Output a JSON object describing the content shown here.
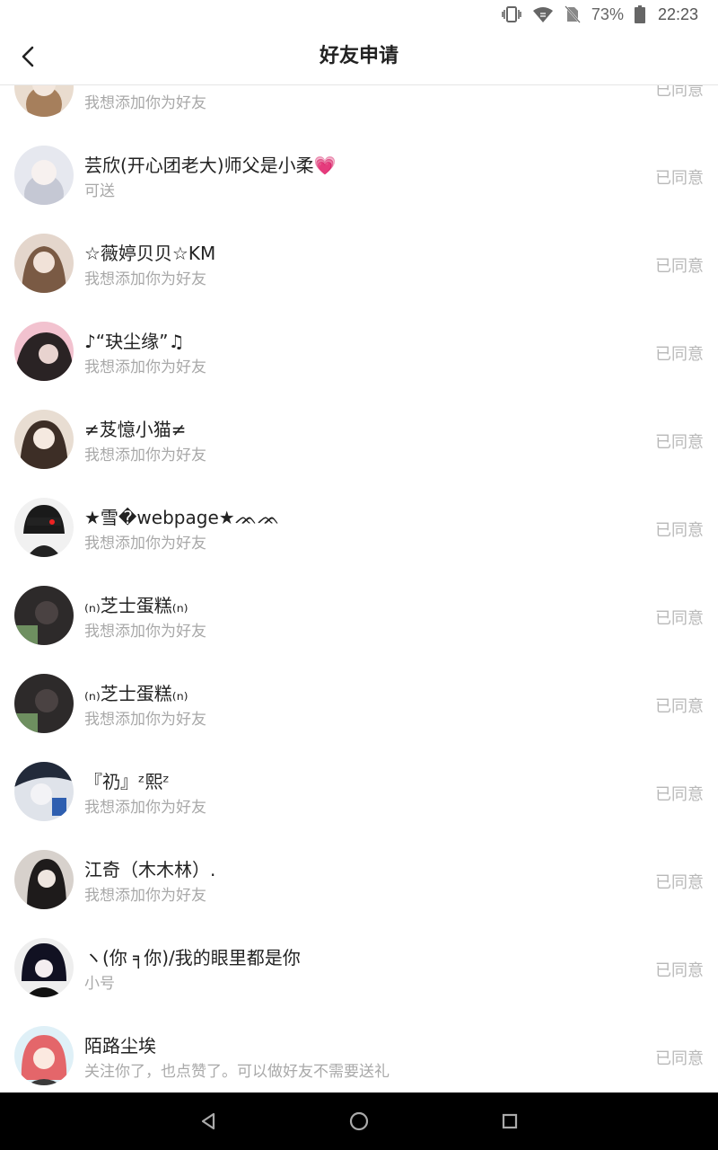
{
  "status": {
    "battery": "73%",
    "time": "22:23"
  },
  "header": {
    "title": "好友申请"
  },
  "requests": [
    {
      "name": "",
      "message": "我想添加你为好友",
      "action": "已同意",
      "avatar": {
        "bg": "#e9dccf",
        "fg": "#a67f5c"
      }
    },
    {
      "name": "芸欣(开心团老大)师父是小柔💗",
      "message": "可送",
      "action": "已同意",
      "avatar": {
        "bg": "#e6e8ef",
        "fg": "#c5c8d4"
      }
    },
    {
      "name": "☆薇婷贝贝☆KM",
      "message": "我想添加你为好友",
      "action": "已同意",
      "avatar": {
        "bg": "#e4d6cc",
        "fg": "#7a5a44"
      }
    },
    {
      "name": "♪“玦尘缘”♫",
      "message": "我想添加你为好友",
      "action": "已同意",
      "avatar": {
        "bg": "#f2c2cf",
        "fg": "#2a2324"
      }
    },
    {
      "name": "≠芨憶小猫≠",
      "message": "我想添加你为好友",
      "action": "已同意",
      "avatar": {
        "bg": "#e8ddd2",
        "fg": "#3d2e26"
      }
    },
    {
      "name": "★雪�webpage★ᨏᨏ",
      "message": "我想添加你为好友",
      "action": "已同意",
      "avatar": {
        "bg": "#f1f1f1",
        "fg": "#1a1a1a"
      }
    },
    {
      "name": "₍ₙ₎芝士蛋糕₍ₙ₎",
      "message": "我想添加你为好友",
      "action": "已同意",
      "avatar": {
        "bg": "#2d2a2a",
        "fg": "#6e8f60"
      }
    },
    {
      "name": "₍ₙ₎芝士蛋糕₍ₙ₎",
      "message": "我想添加你为好友",
      "action": "已同意",
      "avatar": {
        "bg": "#2d2a2a",
        "fg": "#6e8f60"
      }
    },
    {
      "name": "『礽』ᶻ熙ᶻ",
      "message": "我想添加你为好友",
      "action": "已同意",
      "avatar": {
        "bg": "#dfe3ea",
        "fg": "#222a3a"
      }
    },
    {
      "name": "江奇（木木林）.",
      "message": "我想添加你为好友",
      "action": "已同意",
      "avatar": {
        "bg": "#d7d1cc",
        "fg": "#1e1b1b"
      }
    },
    {
      "name": "ヽ(你 ╕你)/我的眼里都是你",
      "message": "小号",
      "action": "已同意",
      "avatar": {
        "bg": "#eeeeee",
        "fg": "#111122"
      }
    },
    {
      "name": "陌路尘埃",
      "message": "关注你了，也点赞了。可以做好友不需要送礼",
      "action": "已同意",
      "avatar": {
        "bg": "#dff0f7",
        "fg": "#e4666a"
      }
    }
  ]
}
